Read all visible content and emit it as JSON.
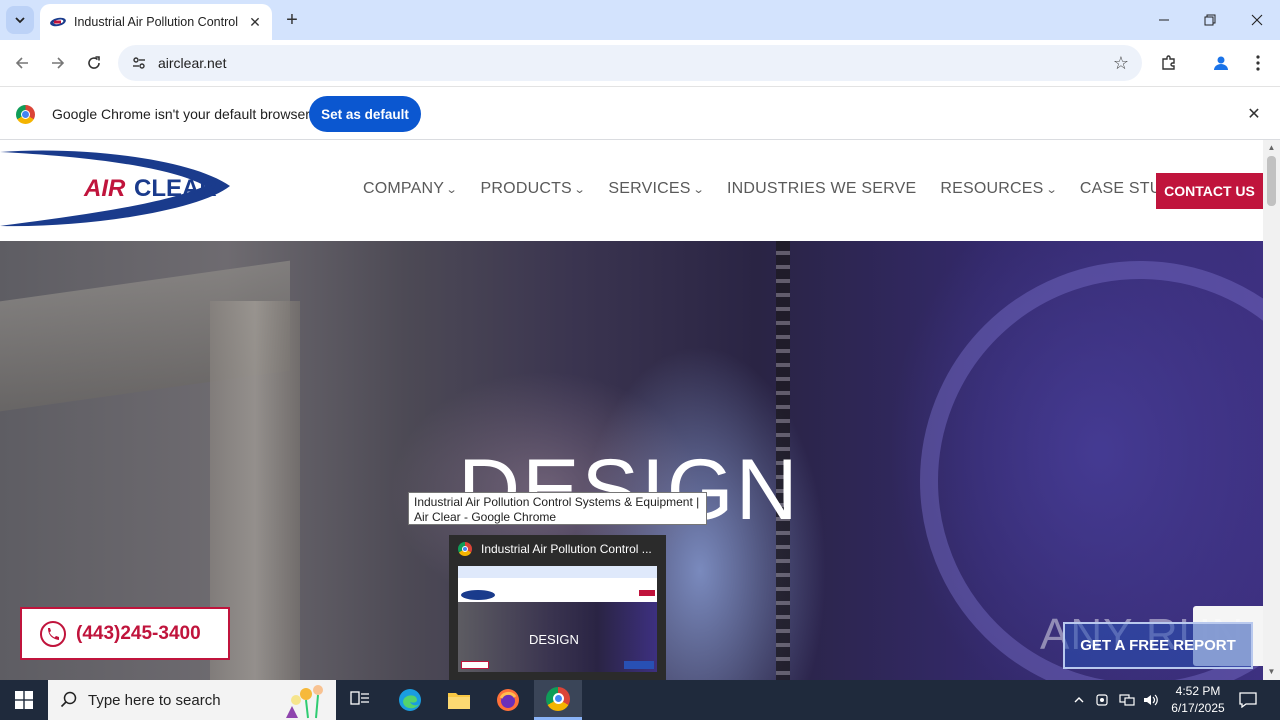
{
  "browser": {
    "tab_title": "Industrial Air Pollution Control",
    "tab_close": "✕",
    "new_tab": "+",
    "url": "airclear.net"
  },
  "infobar": {
    "message": "Google Chrome isn't your default browser",
    "button_label": "Set as default",
    "close": "✕"
  },
  "site": {
    "logo_text_air": "AIR",
    "logo_text_clear": "CLEAR",
    "nav": [
      {
        "label": "COMPANY",
        "dropdown": true
      },
      {
        "label": "PRODUCTS",
        "dropdown": true
      },
      {
        "label": "SERVICES",
        "dropdown": true
      },
      {
        "label": "INDUSTRIES WE SERVE",
        "dropdown": false
      },
      {
        "label": "RESOURCES",
        "dropdown": true
      },
      {
        "label": "CASE STUDIES",
        "dropdown": false
      }
    ],
    "contact_label": "CONTACT US",
    "hero_text": "DESIGN",
    "phone": "(443)245-3400",
    "watermark": "ANY RUN",
    "free_report": "GET A FREE REPORT",
    "colors": {
      "brand_red": "#c0143c",
      "brand_blue": "#1a3b8c"
    }
  },
  "tooltip": {
    "line1": "Industrial Air Pollution Control Systems & Equipment |",
    "line2": "Air Clear - Google Chrome"
  },
  "thumbnail": {
    "title": "Industrial Air Pollution Control ...",
    "preview_text": "DESIGN"
  },
  "taskbar": {
    "search_placeholder": "Type here to search",
    "time": "4:52 PM",
    "date": "6/17/2025"
  }
}
